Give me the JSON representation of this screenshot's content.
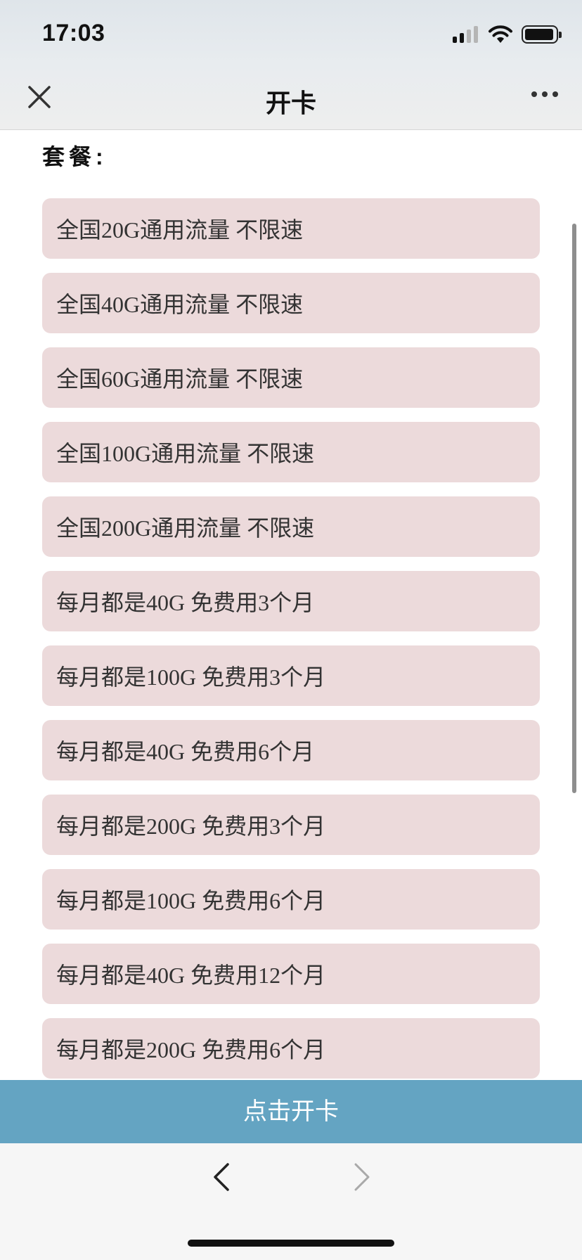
{
  "status_bar": {
    "time": "17:03"
  },
  "nav": {
    "title": "开卡"
  },
  "section": {
    "label": "套餐:"
  },
  "plans": [
    {
      "label": "全国20G通用流量 不限速"
    },
    {
      "label": "全国40G通用流量 不限速"
    },
    {
      "label": "全国60G通用流量 不限速"
    },
    {
      "label": "全国100G通用流量 不限速"
    },
    {
      "label": "全国200G通用流量 不限速"
    },
    {
      "label": "每月都是40G 免费用3个月"
    },
    {
      "label": "每月都是100G 免费用3个月"
    },
    {
      "label": "每月都是40G 免费用6个月"
    },
    {
      "label": "每月都是200G 免费用3个月"
    },
    {
      "label": "每月都是100G 免费用6个月"
    },
    {
      "label": "每月都是40G 免费用12个月"
    },
    {
      "label": "每月都是200G 免费用6个月"
    }
  ],
  "action": {
    "button_label": "点击开卡"
  },
  "colors": {
    "plan_background": "#ecdadb",
    "button_background": "#64a4c2"
  }
}
